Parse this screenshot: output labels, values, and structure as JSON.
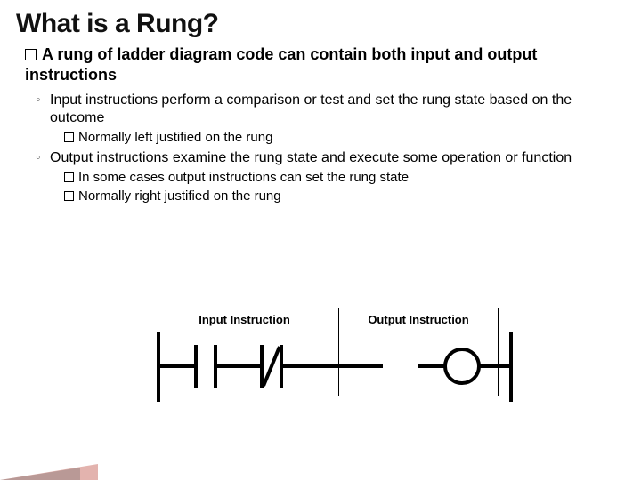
{
  "title": "What is a Rung?",
  "bullets": {
    "lvl1": "A rung of ladder diagram code can contain both input and output instructions",
    "lvl2a": "Input instructions perform a comparison or test and set the rung state based on the outcome",
    "lvl3a": "Normally left justified on the rung",
    "lvl2b": "Output instructions examine the rung state and execute some operation or function",
    "lvl3b1": "In some cases output instructions can set the rung state",
    "lvl3b2": "Normally right justified on the rung"
  },
  "diagram": {
    "input_label": "Input Instruction",
    "output_label": "Output Instruction"
  }
}
